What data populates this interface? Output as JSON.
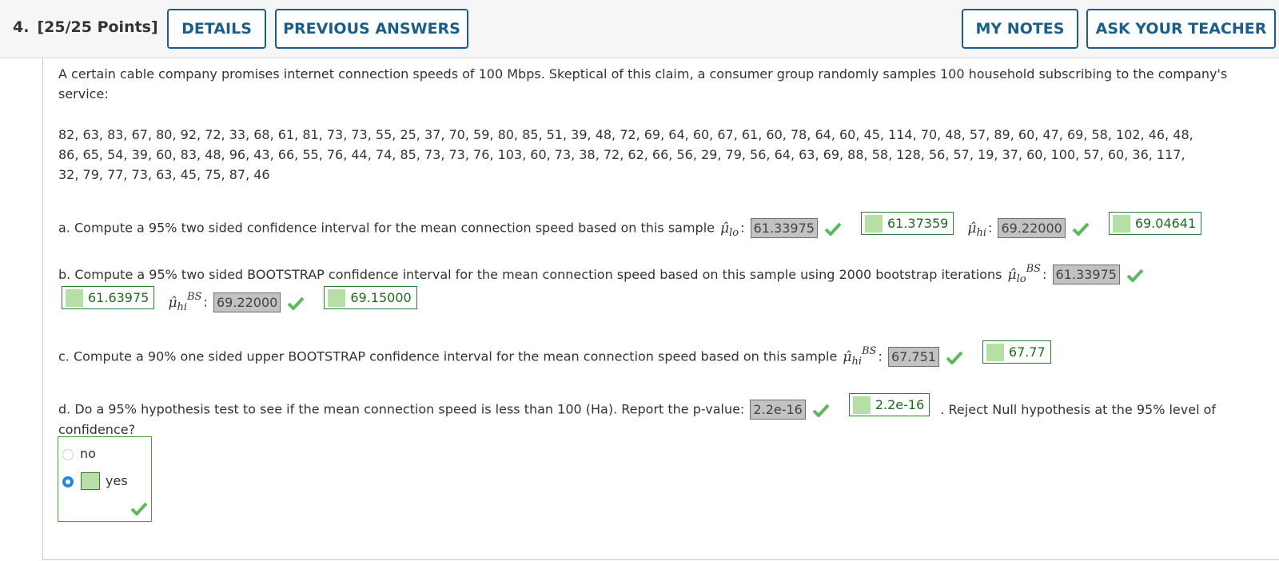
{
  "header": {
    "question_number": "4.",
    "points": "[25/25 Points]",
    "buttons": {
      "details": "DETAILS",
      "previous_answers": "PREVIOUS ANSWERS",
      "my_notes": "MY NOTES",
      "ask_teacher": "ASK YOUR TEACHER"
    }
  },
  "intro": {
    "text": "A certain cable company promises internet connection speeds of 100 Mbps. Skeptical of this claim, a consumer group randomly samples 100 household subscribing to the company's service:",
    "data_line1": "82, 63, 83, 67, 80, 92, 72, 33, 68, 61, 81, 73, 73, 55, 25, 37, 70, 59, 80, 85, 51, 39, 48, 72, 69, 64, 60, 67, 61, 60, 78, 64, 60, 45, 114, 70, 48, 57, 89, 60, 47, 69, 58, 102, 46, 48,",
    "data_line2": "86, 65, 54, 39, 60, 83, 48, 96, 43, 66, 55, 76, 44, 74, 85, 73, 73, 76, 103, 60, 73, 38, 72, 62, 66, 56, 29, 79, 56, 64, 63, 69, 88, 58, 128, 56, 57, 19, 37, 60, 100, 57, 60, 36, 117,",
    "data_line3": "32, 79, 77, 73, 63, 45, 75, 87, 46"
  },
  "part_a": {
    "text": "a. Compute a 95% two sided confidence interval for the mean connection speed based on this sample",
    "mu_lo_sub": "lo",
    "mu_hi_sub": "hi",
    "colon": ":",
    "answer_lo": "61.33975",
    "key_lo": "61.37359",
    "answer_hi": "69.22000",
    "key_hi": "69.04641"
  },
  "part_b": {
    "text": "b. Compute a 95% two sided BOOTSTRAP confidence interval for the mean connection speed based on this sample using 2000 bootstrap iterations",
    "mu_lo_sub": "lo",
    "mu_hi_sub": "hi",
    "sup": "BS",
    "colon": ":",
    "answer_lo": "61.33975",
    "key_lo": "61.63975",
    "answer_hi": "69.22000",
    "key_hi": "69.15000"
  },
  "part_c": {
    "text": "c. Compute a 90% one sided upper BOOTSTRAP confidence interval for the mean connection speed based on this sample",
    "mu_hi_sub": "hi",
    "sup": "BS",
    "colon": ":",
    "answer": "67.751",
    "key": "67.77"
  },
  "part_d": {
    "text": "d. Do a 95% hypothesis test to see if the mean connection speed is less than 100 (Ha). Report the p-value:",
    "answer": "2.2e-16",
    "key": "2.2e-16",
    "tail": ". Reject Null hypothesis at the 95% level of",
    "tail2": "confidence?",
    "options": [
      "no",
      "yes"
    ],
    "selected": "yes"
  },
  "colors": {
    "accent": "#1b5e8a",
    "correct": "#2e7d32",
    "check": "#5cb85c",
    "answer_bg": "#c2c2c2",
    "radio_selected": "#1e88e5"
  }
}
